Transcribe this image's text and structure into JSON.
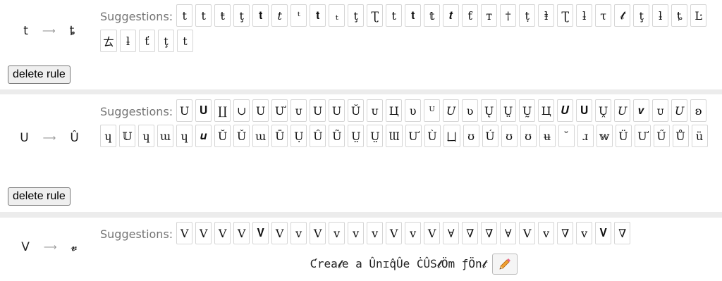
{
  "rules": [
    {
      "from": "t",
      "to": "ȶ",
      "suggestions_label": "Suggestions:",
      "suggestions": [
        "t",
        "t",
        "ŧ",
        "ţ",
        "𝐭",
        "𝑡",
        "ᵗ",
        "𝐭",
        "ₜ",
        "ţ",
        "Ʈ",
        "t",
        "𝐭",
        "𝕥",
        "𝒕",
        "ƭ",
        "ᴛ",
        "†",
        "ṭ",
        "ⱡ",
        "Ʈ",
        "ƚ",
        "τ",
        "𝓽",
        "ţ",
        "ƚ",
        "ȶ",
        "Ŀ",
        "ㄊ",
        "ƚ",
        "ť",
        "ţ",
        "t"
      ],
      "delete_label": "delete rule"
    },
    {
      "from": "U",
      "to": "Û",
      "suggestions_label": "Suggestions:",
      "suggestions": [
        "U",
        "𝐔",
        "∐",
        "∪",
        "U",
        "Ư",
        "ᴜ",
        "U",
        "U",
        "Ŭ",
        "ᴜ",
        "Ц",
        "υ",
        "ᵁ",
        "𝑈",
        "ʋ",
        "Ų",
        "Ṳ",
        "Ṵ",
        "Ц",
        "𝑼",
        "𝐔",
        "Ṷ",
        "𝑈",
        "𝒗",
        "ᴜ",
        "𝑈",
        "ʚ",
        "ɥ",
        "𝕌",
        "ɥ",
        "ɯ",
        "ɥ",
        "𝒖",
        "Ŭ",
        "Ǔ",
        "ɯ",
        "Ū",
        "Ụ",
        "Û",
        "Ũ",
        "Ṳ",
        "Ṳ",
        "Ɯ",
        "Ư",
        "Ù",
        "ㄩ",
        "ʊ",
        "Ú",
        "ʊ",
        "ʊ",
        "ʉ",
        "˘",
        "ɹ",
        "𝕨",
        "Ü",
        "Ư",
        "Ű",
        "Ů",
        "ü"
      ],
      "delete_label": "delete rule"
    },
    {
      "from": "V",
      "to": "𝓿",
      "suggestions_label": "Suggestions:",
      "suggestions": [
        "V",
        "V",
        "V",
        "V",
        "𝐕",
        "V",
        "v",
        "V",
        "v",
        "v",
        "ᴠ",
        "V",
        "v",
        "V",
        "∀",
        "∇",
        "∇",
        "∀",
        "V",
        "v",
        "∇",
        "ᴠ",
        "𝐕",
        "∇"
      ],
      "delete_label": ""
    }
  ],
  "footer": {
    "title": "Ƈrea𝓽e a Ûnɪq̂Ûe ĊÛS𝓽Ӧm ƒӦn𝓽",
    "edit_icon": "pencil-icon"
  }
}
